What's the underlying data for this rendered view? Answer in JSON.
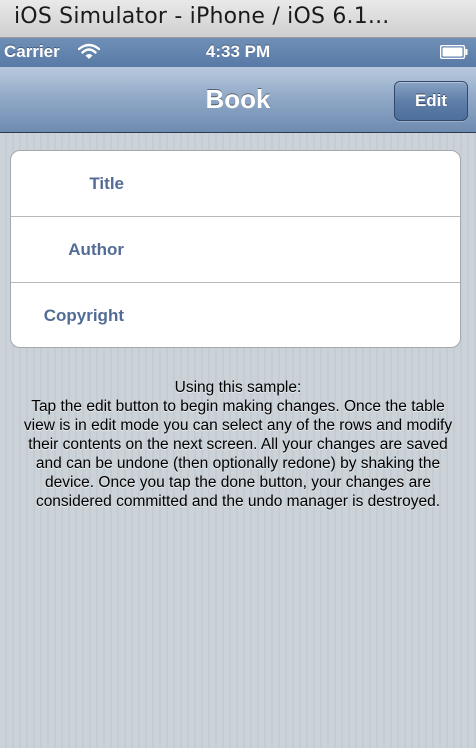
{
  "window": {
    "title": "iOS Simulator - iPhone / iOS 6.1..."
  },
  "status_bar": {
    "carrier": "Carrier",
    "time": "4:33 PM",
    "wifi_icon": "wifi-icon",
    "battery_icon": "battery-icon"
  },
  "nav_bar": {
    "title": "Book",
    "edit_label": "Edit"
  },
  "table": {
    "rows": [
      {
        "label": "Title",
        "value": ""
      },
      {
        "label": "Author",
        "value": ""
      },
      {
        "label": "Copyright",
        "value": ""
      }
    ]
  },
  "instructions": {
    "heading": "Using this sample:",
    "lines": [
      "Tap the edit button to begin making changes.  Once the table",
      "view is in edit mode you can select any of the rows and modify",
      "their contents on the next screen.  All your changes are saved",
      "and can be undone (then optionally redone) by shaking the",
      "device.  Once you tap the done button, your changes are",
      "considered committed and the undo manager is destroyed."
    ]
  },
  "colors": {
    "nav_bar": "#8ea7c6",
    "status_bar": "#6f8fb6",
    "row_label": "#536c95",
    "background": "#c5ccd4"
  }
}
